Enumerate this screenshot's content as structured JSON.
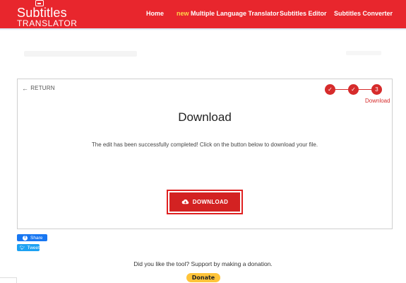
{
  "header": {
    "logo_title": "Subtitles",
    "logo_subtitle": "TRANSLATOR",
    "nav": {
      "home": "Home",
      "new_badge": "new",
      "multi_translator": "Multiple Language Translator",
      "editor": "Subtitles Editor",
      "converter": "Subtitles Converter"
    }
  },
  "card": {
    "return_label": "RETURN",
    "steps": [
      "✓",
      "✓",
      "3"
    ],
    "current_step_label": "Download",
    "title": "Download",
    "message": "The edit has been successfully completed! Click on the button below to download your file.",
    "download_label": "DOWNLOAD"
  },
  "share": {
    "facebook": "Share",
    "twitter": "Tweet"
  },
  "donation": {
    "message": "Did you like the tool? Support by making a donation.",
    "button": "Donate"
  },
  "colors": {
    "brand_red": "#e8262d",
    "step_red": "#d62b2b",
    "facebook_blue": "#1877f2",
    "twitter_blue": "#1da1f2",
    "donate_yellow": "#ffc439"
  },
  "icons": {
    "logo": "subtitle-screen-icon",
    "return": "arrow-left-icon",
    "download": "cloud-download-icon",
    "facebook": "facebook-icon",
    "twitter": "twitter-icon"
  }
}
